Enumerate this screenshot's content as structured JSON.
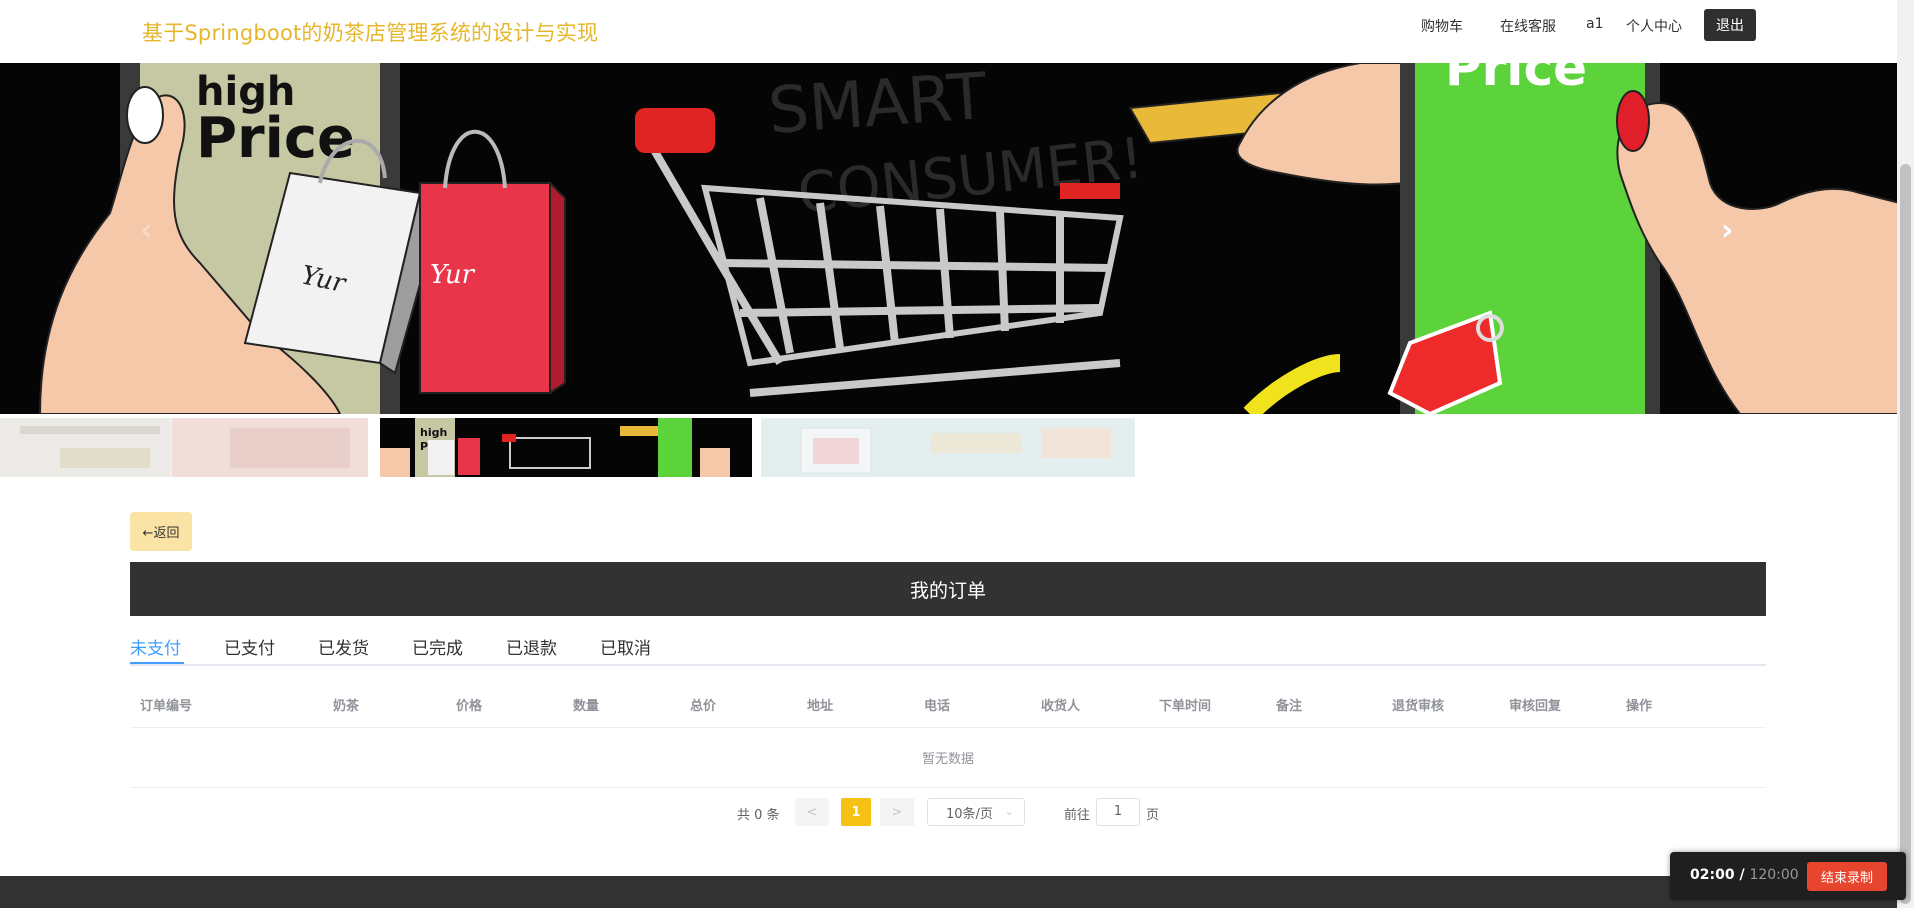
{
  "header": {
    "title": "基于Springboot的奶茶店管理系统的设计与实现",
    "nav": [
      "购物车",
      "在线客服",
      "a1",
      "个人中心"
    ],
    "logout": "退出"
  },
  "banner": {
    "price_left": "high\nPrice",
    "price_right": "Price",
    "bg_text": "SMART CONSUMER!",
    "bag_label": "Yur",
    "thumb_label_1": "high",
    "thumb_label_2": "Price"
  },
  "back_label": "←返回",
  "orders_title": "我的订单",
  "tabs": [
    "未支付",
    "已支付",
    "已发货",
    "已完成",
    "已退款",
    "已取消"
  ],
  "active_tab": "未支付",
  "table": {
    "columns": [
      "订单编号",
      "奶茶",
      "价格",
      "数量",
      "总价",
      "地址",
      "电话",
      "收货人",
      "下单时间",
      "备注",
      "退货审核",
      "审核回复",
      "操作"
    ],
    "empty_text": "暂无数据"
  },
  "pagination": {
    "total_text": "共 0 条",
    "prev": "<",
    "next": ">",
    "current_page": "1",
    "page_size": "10条/页",
    "goto_prefix": "前往",
    "goto_value": "1",
    "goto_suffix": "页"
  },
  "recording": {
    "elapsed": "02:00",
    "separator": " / ",
    "total": "120:00",
    "stop_label": "结束录制"
  },
  "colors": {
    "title": "#e6b62b",
    "active_tab": "#409eff",
    "page_active": "#f5c114",
    "back_button": "#fbe3a5",
    "record_button": "#e8452f"
  }
}
